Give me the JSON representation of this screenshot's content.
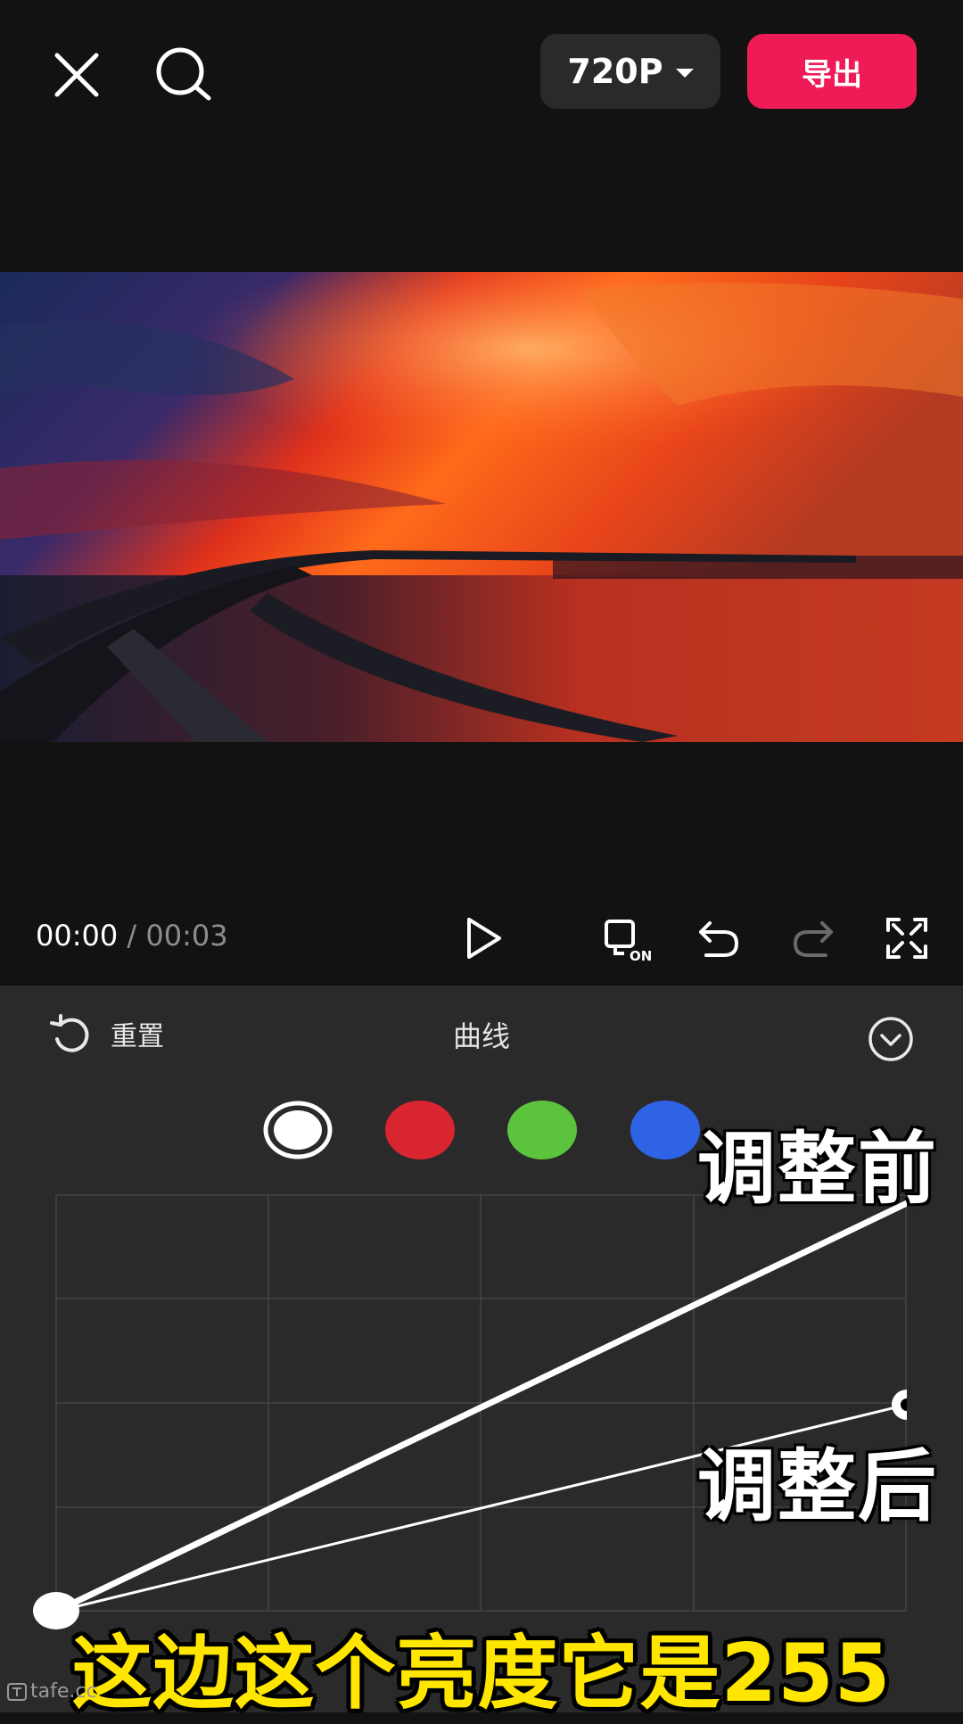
{
  "topbar": {
    "resolution": "720P",
    "export_label": "导出"
  },
  "playback": {
    "current_time": "00:00",
    "separator": " / ",
    "total_time": "00:03"
  },
  "panel": {
    "reset_label": "重置",
    "title": "曲线",
    "channels": [
      {
        "name": "luminance",
        "color": "#ffffff",
        "selected": true
      },
      {
        "name": "red",
        "color": "#d9252f",
        "selected": false
      },
      {
        "name": "green",
        "color": "#5cc43c",
        "selected": false
      },
      {
        "name": "blue",
        "color": "#2e63e6",
        "selected": false
      }
    ]
  },
  "annotations": {
    "before_label": "调整前",
    "after_label": "调整后",
    "subtitle": "这边这个亮度它是255"
  },
  "watermark": "tafe.cc"
}
